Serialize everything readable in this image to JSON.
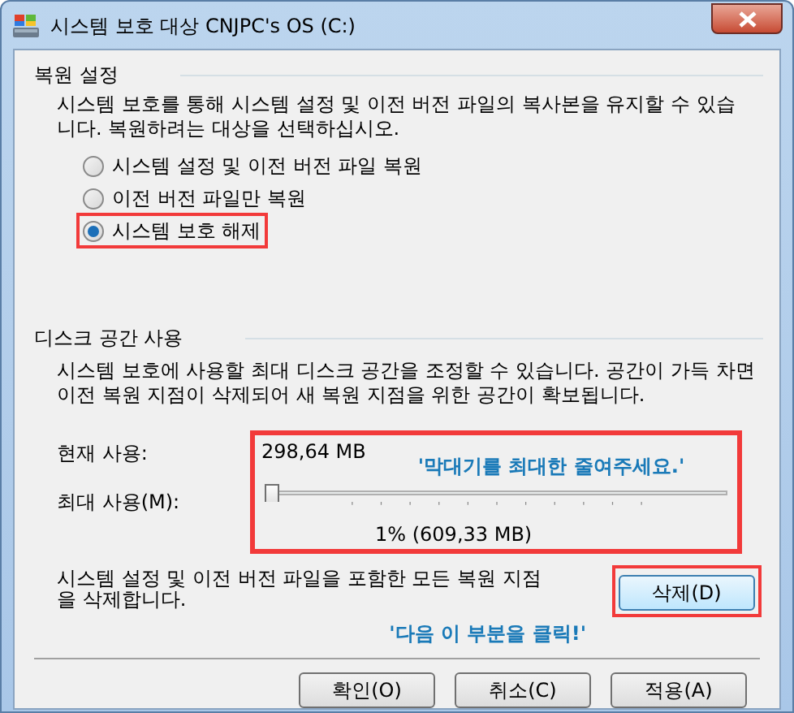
{
  "window": {
    "title": "시스템 보호 대상 CNJPC's OS (C:)"
  },
  "restore_settings": {
    "heading": "복원 설정",
    "description": "시스템 보호를 통해 시스템 설정 및 이전 버전 파일의 복사본을 유지할 수 있습니다. 복원하려는 대상을 선택하십시오.",
    "options": [
      {
        "label": "시스템 설정 및 이전 버전 파일 복원",
        "selected": false,
        "highlighted": false
      },
      {
        "label": "이전 버전 파일만 복원",
        "selected": false,
        "highlighted": false
      },
      {
        "label": "시스템 보호 해제",
        "selected": true,
        "highlighted": true
      }
    ]
  },
  "disk_usage": {
    "heading": "디스크 공간 사용",
    "description": "시스템 보호에 사용할 최대 디스크 공간을 조정할 수 있습니다. 공간이 가득 차면 이전 복원 지점이 삭제되어 새 복원 지점을 위한 공간이 확보됩니다.",
    "current_label": "현재 사용:",
    "current_value": "298,64 MB",
    "max_label": "최대 사용(M):",
    "slider": {
      "level": 0
    },
    "max_reading": "1% (609,33 MB)",
    "highlighted": true,
    "note": "'막대기를 최대한 줄여주세요.'"
  },
  "delete": {
    "description": "시스템 설정 및 이전 버전 파일을 포함한 모든 복원 지점을 삭제합니다.",
    "button": "삭제(D)",
    "highlighted": true,
    "note": "'다음 이 부분을 클릭!'"
  },
  "buttons": [
    "확인(O)",
    "취소(C)",
    "적용(A)"
  ]
}
